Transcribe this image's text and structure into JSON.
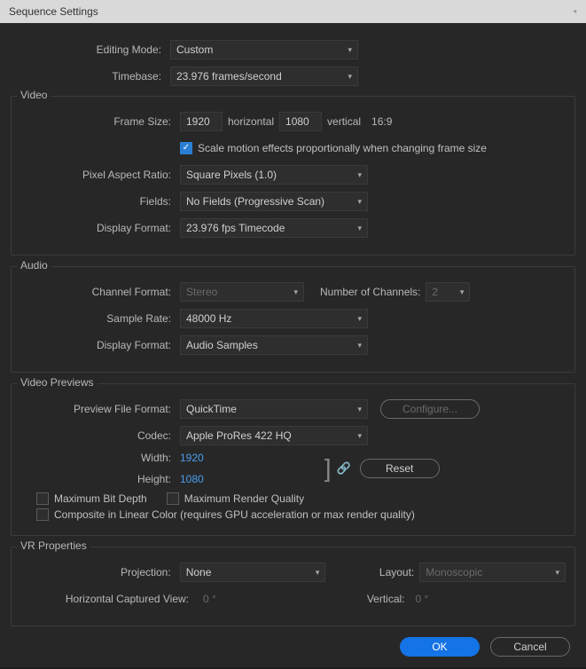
{
  "title": "Sequence Settings",
  "general": {
    "editing_mode_label": "Editing Mode:",
    "editing_mode_value": "Custom",
    "timebase_label": "Timebase:",
    "timebase_value": "23.976  frames/second"
  },
  "video": {
    "section_title": "Video",
    "frame_size_label": "Frame Size:",
    "frame_width": "1920",
    "horizontal_label": "horizontal",
    "frame_height": "1080",
    "vertical_label": "vertical",
    "aspect": "16:9",
    "scale_label": "Scale motion effects proportionally when changing frame size",
    "par_label": "Pixel Aspect Ratio:",
    "par_value": "Square Pixels (1.0)",
    "fields_label": "Fields:",
    "fields_value": "No Fields (Progressive Scan)",
    "display_format_label": "Display Format:",
    "display_format_value": "23.976 fps Timecode"
  },
  "audio": {
    "section_title": "Audio",
    "channel_format_label": "Channel Format:",
    "channel_format_value": "Stereo",
    "num_channels_label": "Number of Channels:",
    "num_channels_value": "2",
    "sample_rate_label": "Sample Rate:",
    "sample_rate_value": "48000 Hz",
    "display_format_label": "Display Format:",
    "display_format_value": "Audio Samples"
  },
  "previews": {
    "section_title": "Video Previews",
    "file_format_label": "Preview File Format:",
    "file_format_value": "QuickTime",
    "configure_label": "Configure...",
    "codec_label": "Codec:",
    "codec_value": "Apple ProRes 422 HQ",
    "width_label": "Width:",
    "width_value": "1920",
    "height_label": "Height:",
    "height_value": "1080",
    "reset_label": "Reset",
    "max_bit_depth_label": "Maximum Bit Depth",
    "max_render_label": "Maximum Render Quality",
    "composite_label": "Composite in Linear Color (requires GPU acceleration or max render quality)"
  },
  "vr": {
    "section_title": "VR Properties",
    "projection_label": "Projection:",
    "projection_value": "None",
    "layout_label": "Layout:",
    "layout_value": "Monoscopic",
    "hcv_label": "Horizontal Captured View:",
    "hcv_value": "0 °",
    "vertical_label": "Vertical:",
    "vertical_value": "0 °"
  },
  "buttons": {
    "ok": "OK",
    "cancel": "Cancel"
  }
}
